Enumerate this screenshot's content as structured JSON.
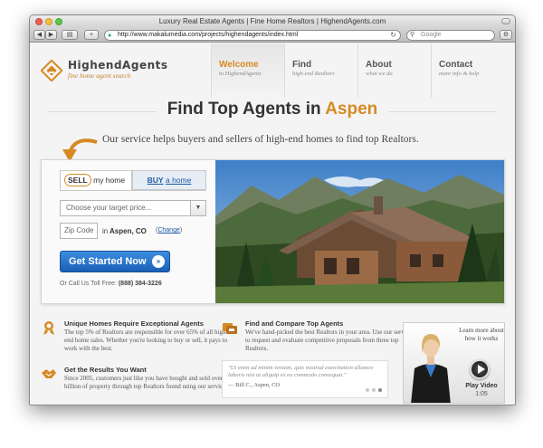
{
  "window": {
    "title": "Luxury Real Estate Agents | Fine Home Realtors | HighendAgents.com"
  },
  "toolbar": {
    "back_icon": "chevron-left-icon",
    "forward_icon": "chevron-right-icon",
    "sidebar_icon": "book-icon",
    "add_label": "+",
    "url": "http://www.makalumedia.com/projects/highendagents/index.html",
    "search_placeholder": "Google"
  },
  "logo": {
    "name": "HighendAgents",
    "tagline": "fine home agent search",
    "accent": "#d68a24"
  },
  "nav": {
    "items": [
      {
        "title": "Welcome",
        "sub": "to HighendAgents"
      },
      {
        "title": "Find",
        "sub": "high-end Realtors"
      },
      {
        "title": "About",
        "sub": "what we do"
      },
      {
        "title": "Contact",
        "sub": "more info & help"
      }
    ]
  },
  "hero_heading": {
    "prefix": "Find Top Agents in",
    "city": "Aspen",
    "subtitle": "Our service helps buyers and sellers of high-end homes to find top Realtors."
  },
  "form": {
    "sell_tab_word": "SELL",
    "sell_tab_rest": "my home",
    "buy_tab_word": "BUY",
    "buy_tab_rest": "a home",
    "price_placeholder": "Choose your target price...",
    "zip_placeholder": "Zip Code",
    "zip_in": "in",
    "zip_city": "Aspen, CO",
    "change_open": "(",
    "change_link": "Change",
    "change_close": ")",
    "cta_label": "Get Started Now",
    "cta_icon": "»",
    "toll_label": "Or Call Us Toll Free:",
    "toll_number": "(888) 384-3226"
  },
  "features": [
    {
      "icon": "award-ribbon-icon",
      "title": "Unique Homes Require Exceptional Agents",
      "body": "The top 5% of Realtors are responsible for over 65% of all high-end home sales. Whether you're looking to buy or sell, it pays to work with the best."
    },
    {
      "icon": "compare-houses-icon",
      "title": "Find and Compare Top Agents",
      "body": "We've hand-picked the best Realtors in your area. Use our service to request and evaluate competitive proposals from three top Realtors."
    },
    {
      "icon": "handshake-icon",
      "title": "Get the Results You Want",
      "body": "Since 2005, customers just like you have bought and sold over $1 billion of property through top Realtors found using our service."
    }
  ],
  "testimonial": {
    "text": "\"Ut enim ad minim veniam, quis nostrud exercitation ullamco laboris nisi ut aliquip ex ea commodo consequat.\"",
    "author": "— Bill C., Aspen, CO",
    "dots_active_index": 2
  },
  "video": {
    "learn": "Learn more about how it works",
    "label": "Play Video",
    "duration": "1:05"
  }
}
